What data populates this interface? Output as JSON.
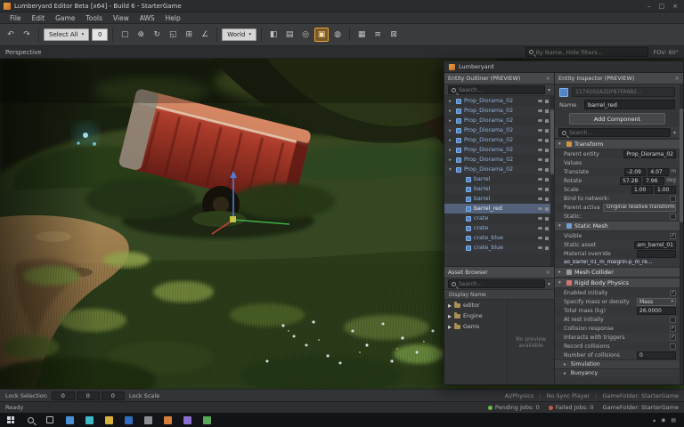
{
  "window": {
    "title": "Lumberyard Editor Beta [x64] - Build 6 - StarterGame",
    "minimize": "–",
    "maximize": "□",
    "close": "×"
  },
  "menu": {
    "items": [
      "File",
      "Edit",
      "Game",
      "Tools",
      "View",
      "AWS",
      "Help"
    ]
  },
  "toolbar": {
    "history": [
      {
        "name": "undo-icon",
        "glyph": "↶"
      },
      {
        "name": "redo-icon",
        "glyph": "↷"
      }
    ],
    "selection_dropdown": "Select All",
    "mask_value": "0",
    "transform_tools": [
      {
        "name": "select-icon",
        "glyph": "▢"
      },
      {
        "name": "move-icon",
        "glyph": "⊕"
      },
      {
        "name": "rotate-icon",
        "glyph": "↻"
      },
      {
        "name": "scale-icon",
        "glyph": "◱"
      },
      {
        "name": "snap-grid-icon",
        "glyph": "⊞"
      },
      {
        "name": "snap-angle-icon",
        "glyph": "∠"
      }
    ],
    "world_dropdown": "World",
    "view_tools": [
      {
        "name": "camera-icon",
        "glyph": "◧"
      },
      {
        "name": "layers-icon",
        "glyph": "▤"
      },
      {
        "name": "goto-icon",
        "glyph": "◎"
      },
      {
        "name": "simulate-icon",
        "glyph": "▣",
        "active": true
      },
      {
        "name": "physics-toggle-icon",
        "glyph": "◍"
      }
    ],
    "right_tools": [
      {
        "name": "grid-icon",
        "glyph": "▦"
      },
      {
        "name": "outline-icon",
        "glyph": "≡"
      },
      {
        "name": "snapshot-icon",
        "glyph": "⊠"
      }
    ]
  },
  "viewport": {
    "label": "Perspective",
    "search_placeholder": "By Name, Hide filters...",
    "fov_label": "FOV: 60°"
  },
  "viewport_footer": {
    "lock_selection": "Lock Selection",
    "coords": [
      "0",
      "0",
      "0"
    ],
    "lock_scale": "Lock Scale",
    "right_items": [
      "AI/Physics",
      "No Sync Player",
      "GameFolder: StarterGame"
    ]
  },
  "statusbar": {
    "ready": "Ready",
    "pending": "Pending Jobs: 0",
    "pending_color": "#6dbb4a",
    "failed": "Failed Jobs: 0",
    "failed_color": "#c05a4a",
    "gamefolder": "GameFolder: StarterGame"
  },
  "float_window": {
    "title": "Lumberyard"
  },
  "outliner": {
    "title": "Entity Outliner (PREVIEW)",
    "search_placeholder": "Search...",
    "items": [
      {
        "label": "Prop_Diorama_02",
        "depth": 0,
        "caret": "▸"
      },
      {
        "label": "Prop_Diorama_02",
        "depth": 0,
        "caret": "▸"
      },
      {
        "label": "Prop_Diorama_02",
        "depth": 0,
        "caret": "▸"
      },
      {
        "label": "Prop_Diorama_02",
        "depth": 0,
        "caret": "▸"
      },
      {
        "label": "Prop_Diorama_02",
        "depth": 0,
        "caret": "▸"
      },
      {
        "label": "Prop_Diorama_02",
        "depth": 0,
        "caret": "▸"
      },
      {
        "label": "Prop_Diorama_02",
        "depth": 0,
        "caret": "▸"
      },
      {
        "label": "Prop_Diorama_02",
        "depth": 0,
        "caret": "▾"
      },
      {
        "label": "barrel",
        "depth": 1
      },
      {
        "label": "barrel",
        "depth": 1
      },
      {
        "label": "barrel",
        "depth": 1
      },
      {
        "label": "barrel_red",
        "depth": 1,
        "selected": true
      },
      {
        "label": "crate",
        "depth": 1
      },
      {
        "label": "crate",
        "depth": 1
      },
      {
        "label": "crate_blue",
        "depth": 1
      },
      {
        "label": "crate_blue",
        "depth": 1
      }
    ]
  },
  "asset_browser": {
    "title": "Asset Browser",
    "search_placeholder": "Search...",
    "column_header": "Display Name",
    "preview_text": "No preview available",
    "items": [
      {
        "label": "editor"
      },
      {
        "label": "Engine"
      },
      {
        "label": "Gems"
      }
    ]
  },
  "inspector": {
    "title": "Entity Inspector (PREVIEW)",
    "entity_id": "1174202A2DF87FA6B2...",
    "name_label": "Name",
    "name_value": "barrel_red",
    "add_component": "Add Component",
    "search_placeholder": "Search...",
    "sections": {
      "transform": {
        "title": "Transform",
        "rows": [
          {
            "label": "Parent entity",
            "control": "field",
            "value": "Prop_Diorama_02"
          },
          {
            "label": "Values",
            "control": "text",
            "value": ""
          },
          {
            "label": "Translate",
            "control": "fields",
            "values": [
              "-2.09",
              "4.07"
            ],
            "unit": "m"
          },
          {
            "label": "Rotate",
            "control": "fields",
            "values": [
              "57.28",
              "7.96"
            ],
            "unit": "deg"
          },
          {
            "label": "Scale",
            "control": "fields",
            "values": [
              "1.00",
              "1.00"
            ],
            "unit": ""
          },
          {
            "label": "Bind to network:",
            "control": "check",
            "checked": false
          },
          {
            "label": "Parent activation",
            "control": "button",
            "value": "Original relative transform"
          },
          {
            "label": "Static:",
            "control": "check",
            "checked": false
          }
        ]
      },
      "static_mesh": {
        "title": "Static Mesh",
        "rows": [
          {
            "label": "Visible",
            "control": "check",
            "checked": true
          },
          {
            "label": "Static asset",
            "control": "field",
            "value": "am_barrel_01"
          },
          {
            "label": "Material override",
            "control": "field",
            "value": ""
          },
          {
            "label": "ao_barrel_01_m_malgrin-p_m_re...",
            "control": "wide"
          }
        ]
      },
      "mesh_collider": {
        "title": "Mesh Collider",
        "rows": []
      },
      "rigid_body": {
        "title": "Rigid Body Physics",
        "rows": [
          {
            "label": "Enabled initially",
            "control": "check",
            "checked": true
          },
          {
            "label": "Specify mass or density",
            "control": "select",
            "value": "Mass"
          },
          {
            "label": "Total mass (kg)",
            "control": "field",
            "value": "26.0000"
          },
          {
            "label": "At rest initially",
            "control": "check",
            "checked": false
          },
          {
            "label": "Collision response",
            "control": "check",
            "checked": true
          },
          {
            "label": "Interacts with triggers",
            "control": "check",
            "checked": true
          },
          {
            "label": "Record collisions",
            "control": "check",
            "checked": false
          },
          {
            "label": "Number of collisions",
            "control": "field",
            "value": "0"
          },
          {
            "label": "Simulation",
            "control": "sub"
          },
          {
            "label": "Buoyancy",
            "control": "sub"
          }
        ]
      }
    }
  },
  "taskbar": {
    "apps": [
      {
        "name": "taskbar-app-icon-1",
        "color": "#4a90d9"
      },
      {
        "name": "taskbar-app-icon-2",
        "color": "#3fb8c9"
      },
      {
        "name": "taskbar-app-icon-3",
        "color": "#d9b23c"
      },
      {
        "name": "taskbar-app-icon-4",
        "color": "#2f6fbe"
      },
      {
        "name": "taskbar-app-icon-5",
        "color": "#8a8d92"
      },
      {
        "name": "taskbar-app-icon-6",
        "color": "#d97e3a"
      },
      {
        "name": "taskbar-app-icon-7",
        "color": "#8a6fd0"
      },
      {
        "name": "taskbar-app-icon-8",
        "color": "#5aa85a"
      }
    ],
    "tray": [
      {
        "name": "tray-chevron-icon",
        "glyph": "▴"
      },
      {
        "name": "tray-network-icon",
        "glyph": "◉"
      },
      {
        "name": "tray-volume-icon",
        "glyph": "▤"
      }
    ]
  }
}
